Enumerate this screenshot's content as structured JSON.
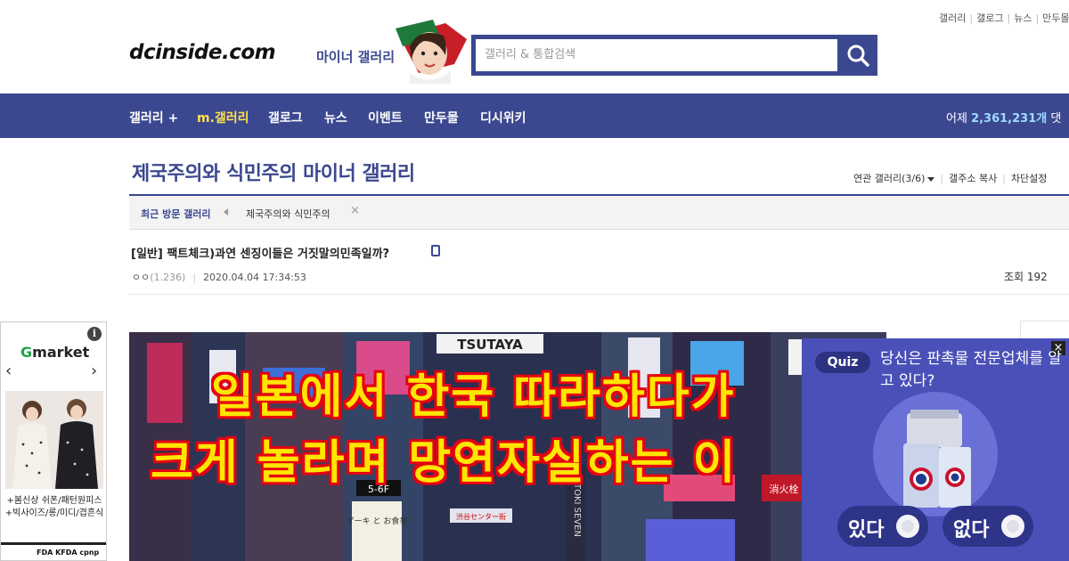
{
  "util_links": [
    "갤러리",
    "갤로그",
    "뉴스",
    "만두몰"
  ],
  "header": {
    "logo": "dcinside.com",
    "subtitle": "마이너 갤러리",
    "search_placeholder": "갤러리 & 통합검색"
  },
  "nav": {
    "items": [
      "갤러리 +",
      "m.갤러리",
      "갤로그",
      "뉴스",
      "이벤트",
      "만두몰",
      "디시위키"
    ],
    "active_index": 1,
    "stat_label": "어제",
    "stat_value": "2,361,231개",
    "stat_suffix": "댓"
  },
  "gallery": {
    "title": "제국주의와 식민주의 마이너 갤러리",
    "related": "연관 갤러리(3/6)",
    "copy": "갤주소 복사",
    "block": "차단설정"
  },
  "recent": {
    "label": "최근 방문 갤러리",
    "item": "제국주의와 식민주의"
  },
  "post": {
    "title": "[일반] 팩트체크)과연 센징이들은 거짓말의민족일까?",
    "author": "ㅇㅇ",
    "ip": "(1.236)",
    "datetime": "2020.04.04 17:34:53",
    "views": "조회 192"
  },
  "ad": {
    "brand_g": "G",
    "brand_rest": "market",
    "info": "i",
    "text": "+봄신상 쉬폰/패턴원피스+빅사이즈/롱/미디/겹흔식",
    "footer": "FDA KFDA cpnp"
  },
  "main_image": {
    "line1": "일본에서 한국 따라하다가",
    "line2": "크게 놀라며 망연자실하는 이",
    "signs": [
      "TSUTAYA",
      "5-6F",
      "TOKI SEVEN",
      "渋谷センター街",
      "ゲーキ と お食事",
      "消火栓"
    ]
  },
  "quiz": {
    "badge": "Quiz",
    "question": "당신은 판촉물 전문업체를 알고 있다?",
    "yes": "있다",
    "no": "없다"
  },
  "colors": {
    "brand": "#3b4890",
    "nav_active": "#ffe14a",
    "quiz_bg": "#4a50b8"
  }
}
